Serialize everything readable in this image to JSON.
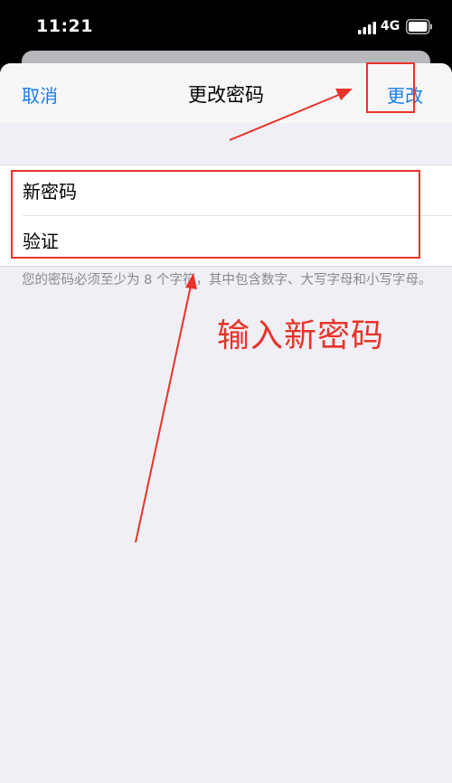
{
  "status_bar": {
    "time": "11:21",
    "network": "4G",
    "icons": [
      "signal-icon",
      "battery-icon"
    ]
  },
  "nav": {
    "cancel_label": "取消",
    "title": "更改密码",
    "submit_label": "更改"
  },
  "form": {
    "new_password_label": "新密码",
    "verify_label": "验证",
    "new_password_value": "",
    "verify_value": ""
  },
  "hint": "您的密码必须至少为 8 个字符，其中包含数字、大写字母和小写字母。",
  "annotation": {
    "text": "输入新密码",
    "color": "#e8332a"
  },
  "colors": {
    "accent": "#1a7de5",
    "background": "#f0eff5"
  }
}
